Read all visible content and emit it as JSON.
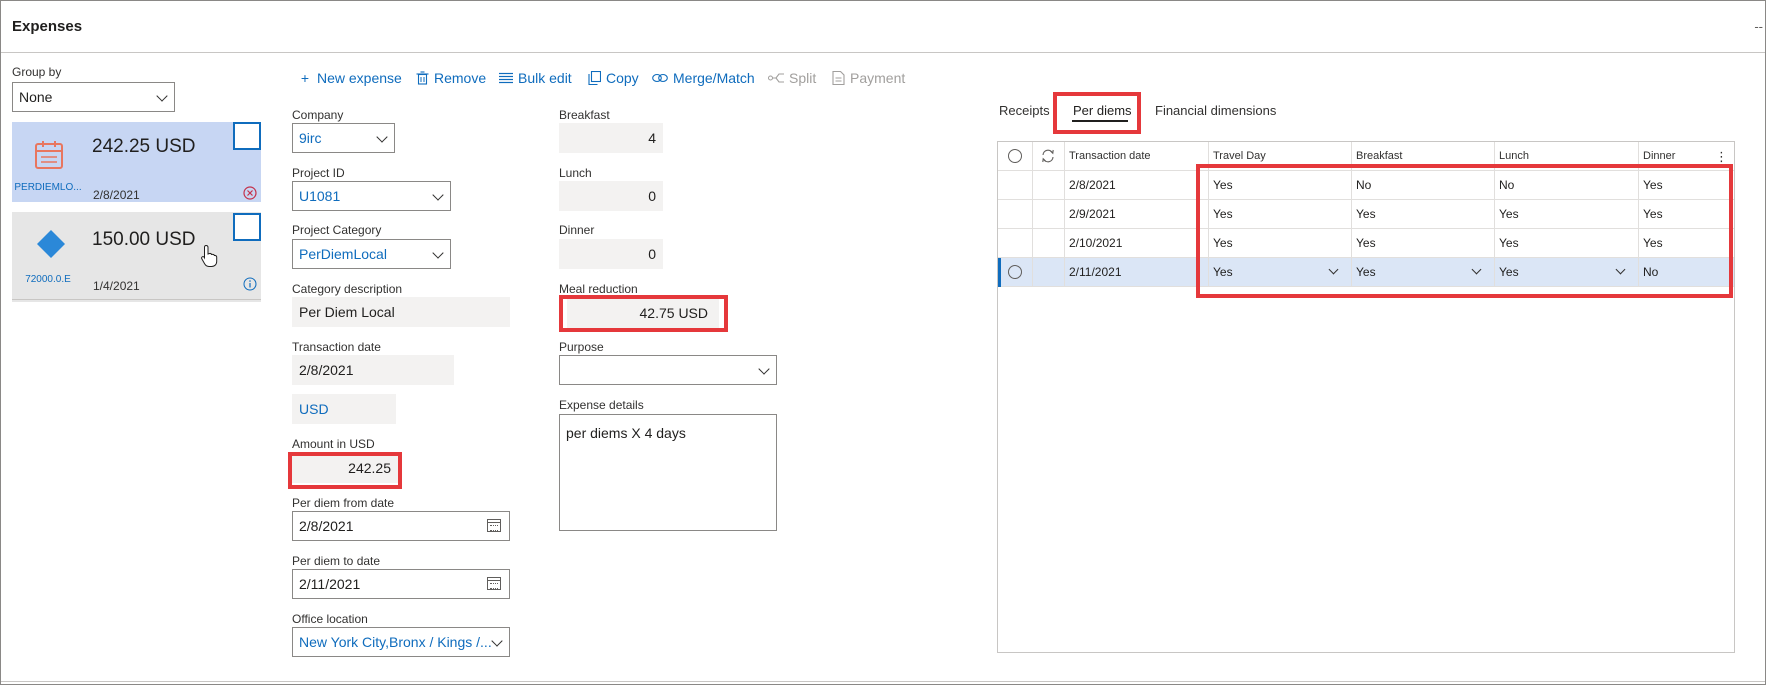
{
  "app": {
    "title": "Expenses",
    "window_control": "--"
  },
  "toolbar": {
    "new_expense": "New expense",
    "remove": "Remove",
    "bulk_edit": "Bulk edit",
    "copy": "Copy",
    "merge_match": "Merge/Match",
    "split": "Split",
    "payment": "Payment"
  },
  "group_by": {
    "label": "Group by",
    "value": "None"
  },
  "expense_list": [
    {
      "amount": "242.25 USD",
      "date": "2/8/2021",
      "code": "PERDIEMLO..."
    },
    {
      "amount": "150.00 USD",
      "date": "1/4/2021",
      "code": "72000.0.E"
    }
  ],
  "form": {
    "company": {
      "label": "Company",
      "value": "9irc"
    },
    "project_id": {
      "label": "Project ID",
      "value": "U1081"
    },
    "project_category": {
      "label": "Project Category",
      "value": "PerDiemLocal"
    },
    "category_description": {
      "label": "Category description",
      "value": "Per Diem Local"
    },
    "transaction_date": {
      "label": "Transaction date",
      "value": "2/8/2021"
    },
    "currency": {
      "value": "USD"
    },
    "amount": {
      "label": "Amount in USD",
      "value": "242.25"
    },
    "per_diem_from": {
      "label": "Per diem from date",
      "value": "2/8/2021"
    },
    "per_diem_to": {
      "label": "Per diem to date",
      "value": "2/11/2021"
    },
    "office_location": {
      "label": "Office location",
      "value": "New York City,Bronx / Kings /..."
    },
    "breakfast": {
      "label": "Breakfast",
      "value": "4"
    },
    "lunch": {
      "label": "Lunch",
      "value": "0"
    },
    "dinner": {
      "label": "Dinner",
      "value": "0"
    },
    "meal_reduction": {
      "label": "Meal reduction",
      "value": "42.75 USD"
    },
    "purpose": {
      "label": "Purpose",
      "value": ""
    },
    "expense_details": {
      "label": "Expense details",
      "value": "per diems X 4 days"
    }
  },
  "tabs": {
    "receipts": "Receipts",
    "per_diems": "Per diems",
    "financial_dimensions": "Financial dimensions"
  },
  "per_diem_grid": {
    "columns": {
      "date": "Transaction date",
      "travel_day": "Travel Day",
      "breakfast": "Breakfast",
      "lunch": "Lunch",
      "dinner": "Dinner"
    },
    "rows": [
      {
        "date": "2/8/2021",
        "travel_day": "Yes",
        "breakfast": "No",
        "lunch": "No",
        "dinner": "Yes"
      },
      {
        "date": "2/9/2021",
        "travel_day": "Yes",
        "breakfast": "Yes",
        "lunch": "Yes",
        "dinner": "Yes"
      },
      {
        "date": "2/10/2021",
        "travel_day": "Yes",
        "breakfast": "Yes",
        "lunch": "Yes",
        "dinner": "Yes"
      },
      {
        "date": "2/11/2021",
        "travel_day": "Yes",
        "breakfast": "Yes",
        "lunch": "Yes",
        "dinner": "No"
      }
    ]
  },
  "colors": {
    "accent": "#0f6cbd",
    "highlight": "#e5383b",
    "selected_card": "#c7d6f3",
    "selected_row": "#dbe6f6"
  }
}
